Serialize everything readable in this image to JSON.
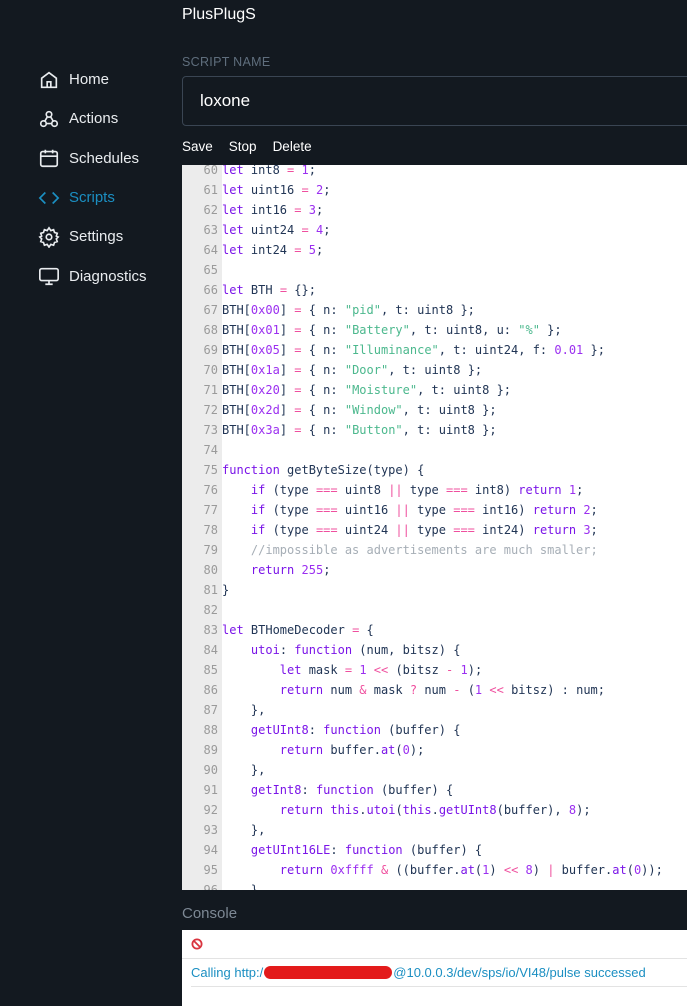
{
  "app_title": "PlusPlugS",
  "nav": [
    {
      "label": "Home",
      "icon": "home-icon"
    },
    {
      "label": "Actions",
      "icon": "webhook-icon"
    },
    {
      "label": "Schedules",
      "icon": "calendar-icon"
    },
    {
      "label": "Scripts",
      "icon": "code-icon",
      "active": true
    },
    {
      "label": "Settings",
      "icon": "gear-icon"
    },
    {
      "label": "Diagnostics",
      "icon": "monitor-icon"
    }
  ],
  "script_name_label": "SCRIPT NAME",
  "script_name_value": "loxone",
  "toolbar": {
    "save": "Save",
    "stop": "Stop",
    "delete": "Delete"
  },
  "code": [
    {
      "n": "60",
      "t": [
        [
          "k",
          "let"
        ],
        [
          "t",
          " int8 "
        ],
        [
          "o",
          "="
        ],
        [
          "t",
          " "
        ],
        [
          "n",
          "1"
        ],
        [
          "t",
          ";"
        ]
      ]
    },
    {
      "n": "61",
      "t": [
        [
          "k",
          "let"
        ],
        [
          "t",
          " uint16 "
        ],
        [
          "o",
          "="
        ],
        [
          "t",
          " "
        ],
        [
          "n",
          "2"
        ],
        [
          "t",
          ";"
        ]
      ]
    },
    {
      "n": "62",
      "t": [
        [
          "k",
          "let"
        ],
        [
          "t",
          " int16 "
        ],
        [
          "o",
          "="
        ],
        [
          "t",
          " "
        ],
        [
          "n",
          "3"
        ],
        [
          "t",
          ";"
        ]
      ]
    },
    {
      "n": "63",
      "t": [
        [
          "k",
          "let"
        ],
        [
          "t",
          " uint24 "
        ],
        [
          "o",
          "="
        ],
        [
          "t",
          " "
        ],
        [
          "n",
          "4"
        ],
        [
          "t",
          ";"
        ]
      ]
    },
    {
      "n": "64",
      "t": [
        [
          "k",
          "let"
        ],
        [
          "t",
          " int24 "
        ],
        [
          "o",
          "="
        ],
        [
          "t",
          " "
        ],
        [
          "n",
          "5"
        ],
        [
          "t",
          ";"
        ]
      ]
    },
    {
      "n": "65",
      "t": []
    },
    {
      "n": "66",
      "t": [
        [
          "k",
          "let"
        ],
        [
          "t",
          " BTH "
        ],
        [
          "o",
          "="
        ],
        [
          "t",
          " {};"
        ]
      ]
    },
    {
      "n": "67",
      "t": [
        [
          "t",
          "BTH["
        ],
        [
          "n",
          "0x00"
        ],
        [
          "t",
          "] "
        ],
        [
          "o",
          "="
        ],
        [
          "t",
          " { n: "
        ],
        [
          "s",
          "\"pid\""
        ],
        [
          "t",
          ", t: uint8 };"
        ]
      ]
    },
    {
      "n": "68",
      "t": [
        [
          "t",
          "BTH["
        ],
        [
          "n",
          "0x01"
        ],
        [
          "t",
          "] "
        ],
        [
          "o",
          "="
        ],
        [
          "t",
          " { n: "
        ],
        [
          "s",
          "\"Battery\""
        ],
        [
          "t",
          ", t: uint8, u: "
        ],
        [
          "s",
          "\"%\""
        ],
        [
          "t",
          " };"
        ]
      ]
    },
    {
      "n": "69",
      "t": [
        [
          "t",
          "BTH["
        ],
        [
          "n",
          "0x05"
        ],
        [
          "t",
          "] "
        ],
        [
          "o",
          "="
        ],
        [
          "t",
          " { n: "
        ],
        [
          "s",
          "\"Illuminance\""
        ],
        [
          "t",
          ", t: uint24, f: "
        ],
        [
          "n",
          "0.01"
        ],
        [
          "t",
          " };"
        ]
      ]
    },
    {
      "n": "70",
      "t": [
        [
          "t",
          "BTH["
        ],
        [
          "n",
          "0x1a"
        ],
        [
          "t",
          "] "
        ],
        [
          "o",
          "="
        ],
        [
          "t",
          " { n: "
        ],
        [
          "s",
          "\"Door\""
        ],
        [
          "t",
          ", t: uint8 };"
        ]
      ]
    },
    {
      "n": "71",
      "t": [
        [
          "t",
          "BTH["
        ],
        [
          "n",
          "0x20"
        ],
        [
          "t",
          "] "
        ],
        [
          "o",
          "="
        ],
        [
          "t",
          " { n: "
        ],
        [
          "s",
          "\"Moisture\""
        ],
        [
          "t",
          ", t: uint8 };"
        ]
      ]
    },
    {
      "n": "72",
      "t": [
        [
          "t",
          "BTH["
        ],
        [
          "n",
          "0x2d"
        ],
        [
          "t",
          "] "
        ],
        [
          "o",
          "="
        ],
        [
          "t",
          " { n: "
        ],
        [
          "s",
          "\"Window\""
        ],
        [
          "t",
          ", t: uint8 };"
        ]
      ]
    },
    {
      "n": "73",
      "t": [
        [
          "t",
          "BTH["
        ],
        [
          "n",
          "0x3a"
        ],
        [
          "t",
          "] "
        ],
        [
          "o",
          "="
        ],
        [
          "t",
          " { n: "
        ],
        [
          "s",
          "\"Button\""
        ],
        [
          "t",
          ", t: uint8 };"
        ]
      ]
    },
    {
      "n": "74",
      "t": []
    },
    {
      "n": "75",
      "t": [
        [
          "k",
          "function"
        ],
        [
          "t",
          " getByteSize(type) {"
        ]
      ]
    },
    {
      "n": "76",
      "t": [
        [
          "t",
          "    "
        ],
        [
          "k",
          "if"
        ],
        [
          "t",
          " (type "
        ],
        [
          "o",
          "==="
        ],
        [
          "t",
          " uint8 "
        ],
        [
          "o",
          "||"
        ],
        [
          "t",
          " type "
        ],
        [
          "o",
          "==="
        ],
        [
          "t",
          " int8) "
        ],
        [
          "k",
          "return"
        ],
        [
          "t",
          " "
        ],
        [
          "n",
          "1"
        ],
        [
          "t",
          ";"
        ]
      ]
    },
    {
      "n": "77",
      "t": [
        [
          "t",
          "    "
        ],
        [
          "k",
          "if"
        ],
        [
          "t",
          " (type "
        ],
        [
          "o",
          "==="
        ],
        [
          "t",
          " uint16 "
        ],
        [
          "o",
          "||"
        ],
        [
          "t",
          " type "
        ],
        [
          "o",
          "==="
        ],
        [
          "t",
          " int16) "
        ],
        [
          "k",
          "return"
        ],
        [
          "t",
          " "
        ],
        [
          "n",
          "2"
        ],
        [
          "t",
          ";"
        ]
      ]
    },
    {
      "n": "78",
      "t": [
        [
          "t",
          "    "
        ],
        [
          "k",
          "if"
        ],
        [
          "t",
          " (type "
        ],
        [
          "o",
          "==="
        ],
        [
          "t",
          " uint24 "
        ],
        [
          "o",
          "||"
        ],
        [
          "t",
          " type "
        ],
        [
          "o",
          "==="
        ],
        [
          "t",
          " int24) "
        ],
        [
          "k",
          "return"
        ],
        [
          "t",
          " "
        ],
        [
          "n",
          "3"
        ],
        [
          "t",
          ";"
        ]
      ]
    },
    {
      "n": "79",
      "t": [
        [
          "t",
          "    "
        ],
        [
          "c",
          "//impossible as advertisements are much smaller;"
        ]
      ]
    },
    {
      "n": "80",
      "t": [
        [
          "t",
          "    "
        ],
        [
          "k",
          "return"
        ],
        [
          "t",
          " "
        ],
        [
          "n",
          "255"
        ],
        [
          "t",
          ";"
        ]
      ]
    },
    {
      "n": "81",
      "t": [
        [
          "t",
          "}"
        ]
      ]
    },
    {
      "n": "82",
      "t": []
    },
    {
      "n": "83",
      "t": [
        [
          "k",
          "let"
        ],
        [
          "t",
          " BTHomeDecoder "
        ],
        [
          "o",
          "="
        ],
        [
          "t",
          " {"
        ]
      ]
    },
    {
      "n": "84",
      "t": [
        [
          "t",
          "    "
        ],
        [
          "k",
          "utoi"
        ],
        [
          "t",
          ": "
        ],
        [
          "k",
          "function"
        ],
        [
          "t",
          " (num, bitsz) {"
        ]
      ]
    },
    {
      "n": "85",
      "t": [
        [
          "t",
          "        "
        ],
        [
          "k",
          "let"
        ],
        [
          "t",
          " mask "
        ],
        [
          "o",
          "="
        ],
        [
          "t",
          " "
        ],
        [
          "n",
          "1"
        ],
        [
          "t",
          " "
        ],
        [
          "o",
          "<<"
        ],
        [
          "t",
          " (bitsz "
        ],
        [
          "o",
          "-"
        ],
        [
          "t",
          " "
        ],
        [
          "n",
          "1"
        ],
        [
          "t",
          ");"
        ]
      ]
    },
    {
      "n": "86",
      "t": [
        [
          "t",
          "        "
        ],
        [
          "k",
          "return"
        ],
        [
          "t",
          " num "
        ],
        [
          "o",
          "&"
        ],
        [
          "t",
          " mask "
        ],
        [
          "o",
          "?"
        ],
        [
          "t",
          " num "
        ],
        [
          "o",
          "-"
        ],
        [
          "t",
          " ("
        ],
        [
          "n",
          "1"
        ],
        [
          "t",
          " "
        ],
        [
          "o",
          "<<"
        ],
        [
          "t",
          " bitsz) : num;"
        ]
      ]
    },
    {
      "n": "87",
      "t": [
        [
          "t",
          "    },"
        ]
      ]
    },
    {
      "n": "88",
      "t": [
        [
          "t",
          "    "
        ],
        [
          "k",
          "getUInt8"
        ],
        [
          "t",
          ": "
        ],
        [
          "k",
          "function"
        ],
        [
          "t",
          " (buffer) {"
        ]
      ]
    },
    {
      "n": "89",
      "t": [
        [
          "t",
          "        "
        ],
        [
          "k",
          "return"
        ],
        [
          "t",
          " buffer."
        ],
        [
          "k",
          "at"
        ],
        [
          "t",
          "("
        ],
        [
          "n",
          "0"
        ],
        [
          "t",
          ");"
        ]
      ]
    },
    {
      "n": "90",
      "t": [
        [
          "t",
          "    },"
        ]
      ]
    },
    {
      "n": "91",
      "t": [
        [
          "t",
          "    "
        ],
        [
          "k",
          "getInt8"
        ],
        [
          "t",
          ": "
        ],
        [
          "k",
          "function"
        ],
        [
          "t",
          " (buffer) {"
        ]
      ]
    },
    {
      "n": "92",
      "t": [
        [
          "t",
          "        "
        ],
        [
          "k",
          "return"
        ],
        [
          "t",
          " "
        ],
        [
          "k",
          "this"
        ],
        [
          "t",
          "."
        ],
        [
          "k",
          "utoi"
        ],
        [
          "t",
          "("
        ],
        [
          "k",
          "this"
        ],
        [
          "t",
          "."
        ],
        [
          "k",
          "getUInt8"
        ],
        [
          "t",
          "(buffer), "
        ],
        [
          "n",
          "8"
        ],
        [
          "t",
          ");"
        ]
      ]
    },
    {
      "n": "93",
      "t": [
        [
          "t",
          "    },"
        ]
      ]
    },
    {
      "n": "94",
      "t": [
        [
          "t",
          "    "
        ],
        [
          "k",
          "getUInt16LE"
        ],
        [
          "t",
          ": "
        ],
        [
          "k",
          "function"
        ],
        [
          "t",
          " (buffer) {"
        ]
      ]
    },
    {
      "n": "95",
      "t": [
        [
          "t",
          "        "
        ],
        [
          "k",
          "return"
        ],
        [
          "t",
          " "
        ],
        [
          "n",
          "0xffff"
        ],
        [
          "t",
          " "
        ],
        [
          "o",
          "&"
        ],
        [
          "t",
          " ((buffer."
        ],
        [
          "k",
          "at"
        ],
        [
          "t",
          "("
        ],
        [
          "n",
          "1"
        ],
        [
          "t",
          ") "
        ],
        [
          "o",
          "<<"
        ],
        [
          "t",
          " "
        ],
        [
          "n",
          "8"
        ],
        [
          "t",
          ") "
        ],
        [
          "o",
          "|"
        ],
        [
          "t",
          " buffer."
        ],
        [
          "k",
          "at"
        ],
        [
          "t",
          "("
        ],
        [
          "n",
          "0"
        ],
        [
          "t",
          "));"
        ]
      ]
    },
    {
      "n": "96",
      "t": [
        [
          "t",
          "    },"
        ]
      ]
    }
  ],
  "console": {
    "title": "Console",
    "clear_icon": "clear-icon",
    "log_prefix": "Calling http:/",
    "log_suffix": "@10.0.0.3/dev/sps/io/VI48/pulse successed"
  }
}
